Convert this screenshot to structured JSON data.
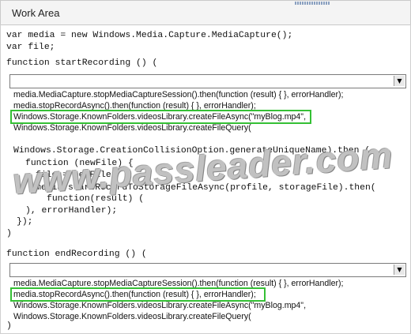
{
  "header": {
    "title": "Work Area"
  },
  "code": {
    "line1": "var media = new Windows.Media.Capture.MediaCapture();",
    "line2": "var file;",
    "line3": "function startRecording () (",
    "line4": "Windows.Storage.CreationCollisionOption.generateUniqueName).then (",
    "line5": "function (newFile) {",
    "line6": "file = newFile;",
    "line7": "media.startRecordToStorageFileAsync(profile, storageFile).then(",
    "line8": "function(result) (",
    "line9": "), errorHandler);",
    "line10": "});",
    "line11": ")",
    "line12": "function endRecording () (",
    "line13": ")"
  },
  "dropdown1": {
    "options": [
      "media.MediaCapture.stopMediaCaptureSession().then(function (result) { }, errorHandler);",
      "media.stopRecordAsync().then(function (result) { }, errorHandler);",
      "Windows.Storage.KnownFolders.videosLibrary.createFileAsync(\"myBlog.mp4\",",
      "Windows.Storage.KnownFolders.videosLibrary.createFileQuery("
    ],
    "selected_index": 2
  },
  "dropdown2": {
    "options": [
      "media.MediaCapture.stopMediaCaptureSession().then(function (result) { }, errorHandler);",
      "media.stopRecordAsync().then(function (result) { }, errorHandler);",
      "Windows.Storage.KnownFolders.videosLibrary.createFileAsync(\"myBlog.mp4\",",
      "Windows.Storage.KnownFolders.videosLibrary.createFileQuery("
    ],
    "selected_index": 1
  },
  "watermark": "www.passleader.com",
  "colors": {
    "highlight": "#35c035"
  },
  "icons": {
    "dropdown_arrow": "dropdown-arrow-icon"
  }
}
